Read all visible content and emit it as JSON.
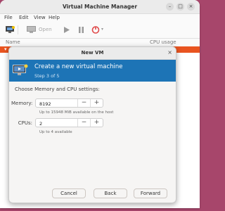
{
  "app": {
    "title": "Virtual Machine Manager"
  },
  "window_controls": {
    "minimize": "–",
    "maximize": "□",
    "close": "×"
  },
  "menu": [
    "File",
    "Edit",
    "View",
    "Help"
  ],
  "toolbar": {
    "open_label": "Open"
  },
  "list": {
    "name_header": "Name",
    "cpu_header": "CPU usage"
  },
  "dialog": {
    "title": "New VM",
    "close": "×",
    "banner_title": "Create a new virtual machine",
    "banner_step": "Step 3 of 5",
    "section_label": "Choose Memory and CPU settings:",
    "memory": {
      "label": "Memory:",
      "value": "8192",
      "hint": "Up to 15948 MiB available on the host"
    },
    "cpus": {
      "label": "CPUs:",
      "value": "2",
      "hint": "Up to 4 available"
    },
    "minus": "−",
    "plus": "+",
    "buttons": {
      "cancel": "Cancel",
      "back": "Back",
      "forward": "Forward"
    }
  },
  "colors": {
    "accent": "#e95420",
    "banner": "#1d74b6",
    "stop": "#e04a4a"
  }
}
